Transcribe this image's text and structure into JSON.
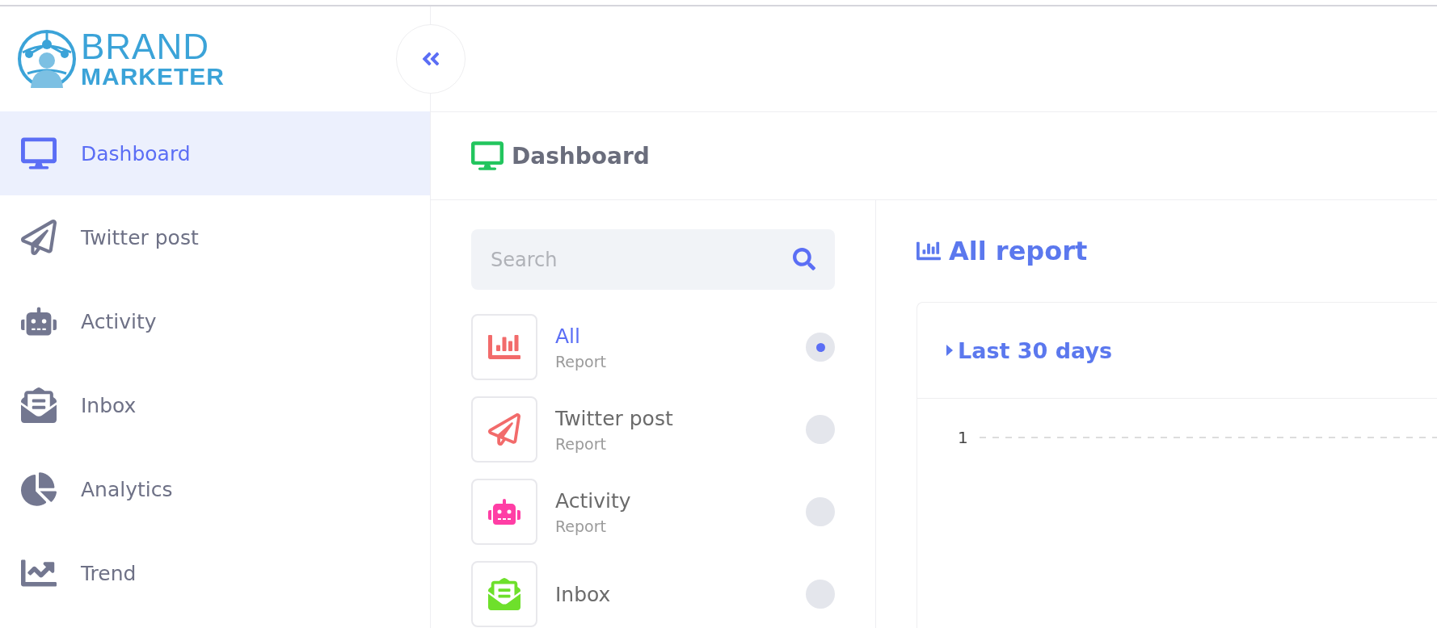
{
  "logo": {
    "top": "BRAND",
    "bottom": "MARKETER"
  },
  "sidebar": {
    "items": [
      {
        "label": "Dashboard",
        "selected": true
      },
      {
        "label": "Twitter post",
        "selected": false
      },
      {
        "label": "Activity",
        "selected": false
      },
      {
        "label": "Inbox",
        "selected": false
      },
      {
        "label": "Analytics",
        "selected": false
      },
      {
        "label": "Trend",
        "selected": false
      }
    ]
  },
  "page_header": {
    "title": "Dashboard"
  },
  "search": {
    "placeholder": "Search"
  },
  "reports": [
    {
      "title": "All",
      "subtitle": "Report",
      "color": "#f26b6b",
      "selected": true
    },
    {
      "title": "Twitter post",
      "subtitle": "Report",
      "color": "#f26b6b",
      "selected": false
    },
    {
      "title": "Activity",
      "subtitle": "Report",
      "color": "#ff3ea5",
      "selected": false
    },
    {
      "title": "Inbox",
      "color": "#6ee02b",
      "selected": false
    }
  ],
  "report_panel": {
    "title": "All report",
    "period": {
      "label": "Last 30 days",
      "expanded": false
    },
    "chart": {
      "y_tick": "1"
    }
  }
}
